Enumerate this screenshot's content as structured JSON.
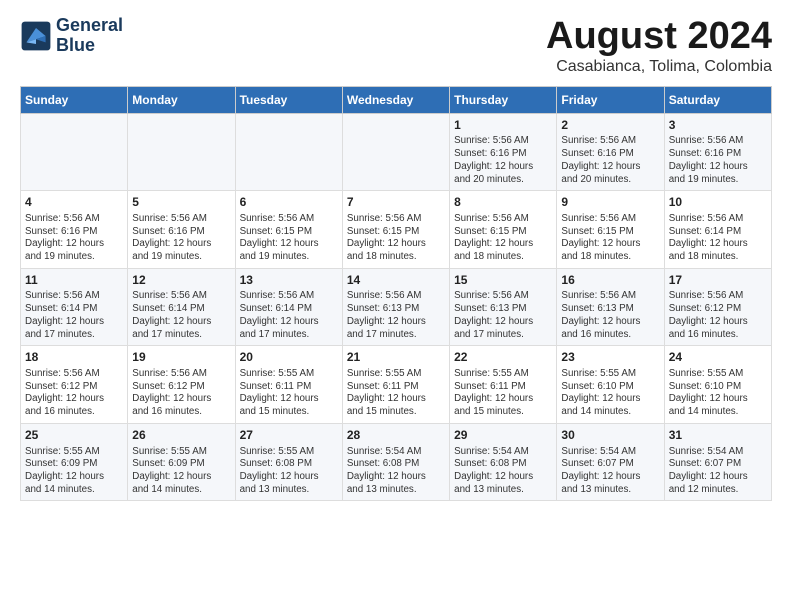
{
  "header": {
    "logo_line1": "General",
    "logo_line2": "Blue",
    "main_title": "August 2024",
    "subtitle": "Casabianca, Tolima, Colombia"
  },
  "calendar": {
    "days_of_week": [
      "Sunday",
      "Monday",
      "Tuesday",
      "Wednesday",
      "Thursday",
      "Friday",
      "Saturday"
    ],
    "weeks": [
      [
        {
          "day": "",
          "info": ""
        },
        {
          "day": "",
          "info": ""
        },
        {
          "day": "",
          "info": ""
        },
        {
          "day": "",
          "info": ""
        },
        {
          "day": "1",
          "info": "Sunrise: 5:56 AM\nSunset: 6:16 PM\nDaylight: 12 hours\nand 20 minutes."
        },
        {
          "day": "2",
          "info": "Sunrise: 5:56 AM\nSunset: 6:16 PM\nDaylight: 12 hours\nand 20 minutes."
        },
        {
          "day": "3",
          "info": "Sunrise: 5:56 AM\nSunset: 6:16 PM\nDaylight: 12 hours\nand 19 minutes."
        }
      ],
      [
        {
          "day": "4",
          "info": "Sunrise: 5:56 AM\nSunset: 6:16 PM\nDaylight: 12 hours\nand 19 minutes."
        },
        {
          "day": "5",
          "info": "Sunrise: 5:56 AM\nSunset: 6:16 PM\nDaylight: 12 hours\nand 19 minutes."
        },
        {
          "day": "6",
          "info": "Sunrise: 5:56 AM\nSunset: 6:15 PM\nDaylight: 12 hours\nand 19 minutes."
        },
        {
          "day": "7",
          "info": "Sunrise: 5:56 AM\nSunset: 6:15 PM\nDaylight: 12 hours\nand 18 minutes."
        },
        {
          "day": "8",
          "info": "Sunrise: 5:56 AM\nSunset: 6:15 PM\nDaylight: 12 hours\nand 18 minutes."
        },
        {
          "day": "9",
          "info": "Sunrise: 5:56 AM\nSunset: 6:15 PM\nDaylight: 12 hours\nand 18 minutes."
        },
        {
          "day": "10",
          "info": "Sunrise: 5:56 AM\nSunset: 6:14 PM\nDaylight: 12 hours\nand 18 minutes."
        }
      ],
      [
        {
          "day": "11",
          "info": "Sunrise: 5:56 AM\nSunset: 6:14 PM\nDaylight: 12 hours\nand 17 minutes."
        },
        {
          "day": "12",
          "info": "Sunrise: 5:56 AM\nSunset: 6:14 PM\nDaylight: 12 hours\nand 17 minutes."
        },
        {
          "day": "13",
          "info": "Sunrise: 5:56 AM\nSunset: 6:14 PM\nDaylight: 12 hours\nand 17 minutes."
        },
        {
          "day": "14",
          "info": "Sunrise: 5:56 AM\nSunset: 6:13 PM\nDaylight: 12 hours\nand 17 minutes."
        },
        {
          "day": "15",
          "info": "Sunrise: 5:56 AM\nSunset: 6:13 PM\nDaylight: 12 hours\nand 17 minutes."
        },
        {
          "day": "16",
          "info": "Sunrise: 5:56 AM\nSunset: 6:13 PM\nDaylight: 12 hours\nand 16 minutes."
        },
        {
          "day": "17",
          "info": "Sunrise: 5:56 AM\nSunset: 6:12 PM\nDaylight: 12 hours\nand 16 minutes."
        }
      ],
      [
        {
          "day": "18",
          "info": "Sunrise: 5:56 AM\nSunset: 6:12 PM\nDaylight: 12 hours\nand 16 minutes."
        },
        {
          "day": "19",
          "info": "Sunrise: 5:56 AM\nSunset: 6:12 PM\nDaylight: 12 hours\nand 16 minutes."
        },
        {
          "day": "20",
          "info": "Sunrise: 5:55 AM\nSunset: 6:11 PM\nDaylight: 12 hours\nand 15 minutes."
        },
        {
          "day": "21",
          "info": "Sunrise: 5:55 AM\nSunset: 6:11 PM\nDaylight: 12 hours\nand 15 minutes."
        },
        {
          "day": "22",
          "info": "Sunrise: 5:55 AM\nSunset: 6:11 PM\nDaylight: 12 hours\nand 15 minutes."
        },
        {
          "day": "23",
          "info": "Sunrise: 5:55 AM\nSunset: 6:10 PM\nDaylight: 12 hours\nand 14 minutes."
        },
        {
          "day": "24",
          "info": "Sunrise: 5:55 AM\nSunset: 6:10 PM\nDaylight: 12 hours\nand 14 minutes."
        }
      ],
      [
        {
          "day": "25",
          "info": "Sunrise: 5:55 AM\nSunset: 6:09 PM\nDaylight: 12 hours\nand 14 minutes."
        },
        {
          "day": "26",
          "info": "Sunrise: 5:55 AM\nSunset: 6:09 PM\nDaylight: 12 hours\nand 14 minutes."
        },
        {
          "day": "27",
          "info": "Sunrise: 5:55 AM\nSunset: 6:08 PM\nDaylight: 12 hours\nand 13 minutes."
        },
        {
          "day": "28",
          "info": "Sunrise: 5:54 AM\nSunset: 6:08 PM\nDaylight: 12 hours\nand 13 minutes."
        },
        {
          "day": "29",
          "info": "Sunrise: 5:54 AM\nSunset: 6:08 PM\nDaylight: 12 hours\nand 13 minutes."
        },
        {
          "day": "30",
          "info": "Sunrise: 5:54 AM\nSunset: 6:07 PM\nDaylight: 12 hours\nand 13 minutes."
        },
        {
          "day": "31",
          "info": "Sunrise: 5:54 AM\nSunset: 6:07 PM\nDaylight: 12 hours\nand 12 minutes."
        }
      ]
    ]
  }
}
